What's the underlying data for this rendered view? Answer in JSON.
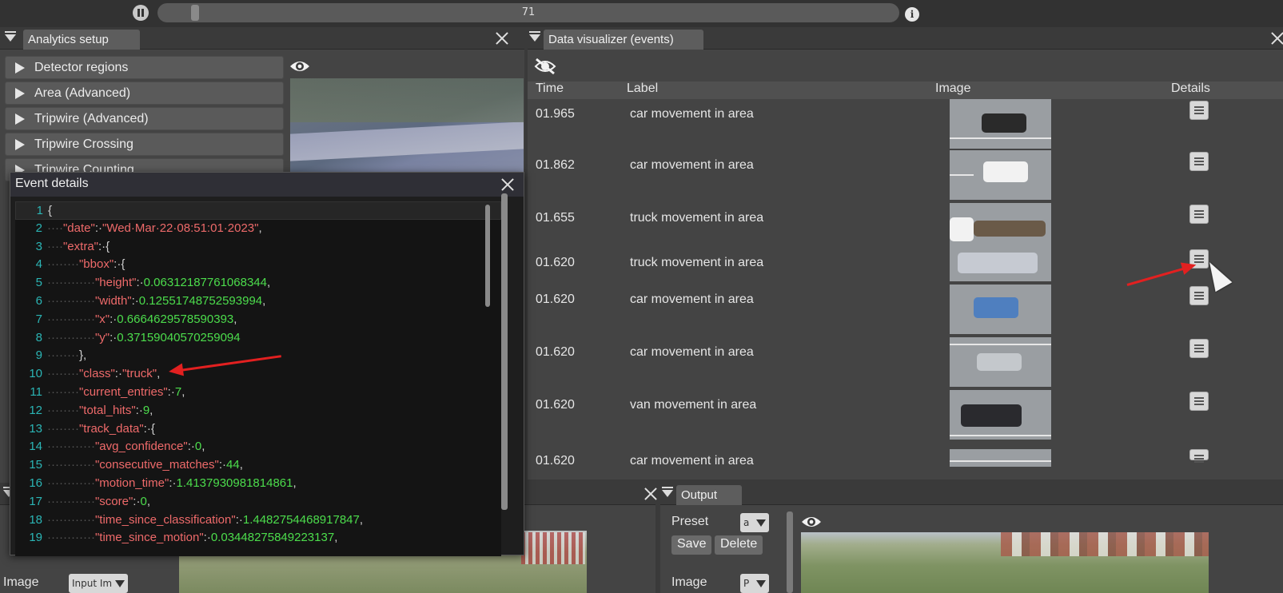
{
  "toolbar": {
    "frame_value": "71"
  },
  "analytics": {
    "tab_label": "Analytics setup",
    "sections": [
      "Detector regions",
      "Area (Advanced)",
      "Tripwire (Advanced)",
      "Tripwire Crossing",
      "Tripwire Counting"
    ]
  },
  "dataviz": {
    "tab_label": "Data visualizer (events)",
    "columns": {
      "time": "Time",
      "label": "Label",
      "image": "Image",
      "details": "Details"
    },
    "rows": [
      {
        "time": "01.965",
        "label": "car movement in area"
      },
      {
        "time": "01.862",
        "label": "car movement in area"
      },
      {
        "time": "01.655",
        "label": "truck movement in area"
      },
      {
        "time": "01.620",
        "label": "truck movement in area"
      },
      {
        "time": "01.620",
        "label": "car movement in area"
      },
      {
        "time": "01.620",
        "label": "car movement in area"
      },
      {
        "time": "01.620",
        "label": "van movement in area"
      },
      {
        "time": "01.620",
        "label": "car movement in area"
      }
    ]
  },
  "event_details": {
    "title": "Event details",
    "line_numbers": [
      "1",
      "2",
      "3",
      "4",
      "5",
      "6",
      "7",
      "8",
      "9",
      "10",
      "11",
      "12",
      "13",
      "14",
      "15",
      "16",
      "17",
      "18",
      "19"
    ],
    "lines": [
      {
        "pre": "",
        "key": "",
        "sep": "{",
        "val": "",
        "end": ""
      },
      {
        "pre": "····",
        "key": "\"date\"",
        "sep": ":·",
        "val": "\"Wed·Mar·22·08:51:01·2023\"",
        "end": ","
      },
      {
        "pre": "····",
        "key": "\"extra\"",
        "sep": ":·{",
        "val": "",
        "end": ""
      },
      {
        "pre": "········",
        "key": "\"bbox\"",
        "sep": ":·{",
        "val": "",
        "end": ""
      },
      {
        "pre": "············",
        "key": "\"height\"",
        "sep": ":·",
        "val": "0.06312187761068344",
        "end": ","
      },
      {
        "pre": "············",
        "key": "\"width\"",
        "sep": ":·",
        "val": "0.12551748752593994",
        "end": ","
      },
      {
        "pre": "············",
        "key": "\"x\"",
        "sep": ":·",
        "val": "0.6664629578590393",
        "end": ","
      },
      {
        "pre": "············",
        "key": "\"y\"",
        "sep": ":·",
        "val": "0.37159040570259094",
        "end": ""
      },
      {
        "pre": "········",
        "key": "",
        "sep": "},",
        "val": "",
        "end": ""
      },
      {
        "pre": "········",
        "key": "\"class\"",
        "sep": ":·",
        "val": "\"truck\"",
        "end": ","
      },
      {
        "pre": "········",
        "key": "\"current_entries\"",
        "sep": ":·",
        "val": "7",
        "end": ","
      },
      {
        "pre": "········",
        "key": "\"total_hits\"",
        "sep": ":·",
        "val": "9",
        "end": ","
      },
      {
        "pre": "········",
        "key": "\"track_data\"",
        "sep": ":·{",
        "val": "",
        "end": ""
      },
      {
        "pre": "············",
        "key": "\"avg_confidence\"",
        "sep": ":·",
        "val": "0",
        "end": ","
      },
      {
        "pre": "············",
        "key": "\"consecutive_matches\"",
        "sep": ":·",
        "val": "44",
        "end": ","
      },
      {
        "pre": "············",
        "key": "\"motion_time\"",
        "sep": ":·",
        "val": "1.4137930981814861",
        "end": ","
      },
      {
        "pre": "············",
        "key": "\"score\"",
        "sep": ":·",
        "val": "0",
        "end": ","
      },
      {
        "pre": "············",
        "key": "\"time_since_classification\"",
        "sep": ":·",
        "val": "1.4482754468917847",
        "end": ","
      },
      {
        "pre": "············",
        "key": "\"time_since_motion\"",
        "sep": ":·",
        "val": "0.03448275849223137",
        "end": ","
      }
    ]
  },
  "output": {
    "tab_label": "Output",
    "preset_label": "Preset",
    "preset_value": "a",
    "save_label": "Save",
    "delete_label": "Delete",
    "image_label": "Image",
    "image_value": "P"
  },
  "bottom_left": {
    "image_label": "Image",
    "image_value": "Input Im"
  },
  "colors": {
    "accent_red": "#e22020",
    "json_key": "#ee6a6a",
    "json_number": "#4cdd4c",
    "line_number": "#2bb5b5"
  }
}
